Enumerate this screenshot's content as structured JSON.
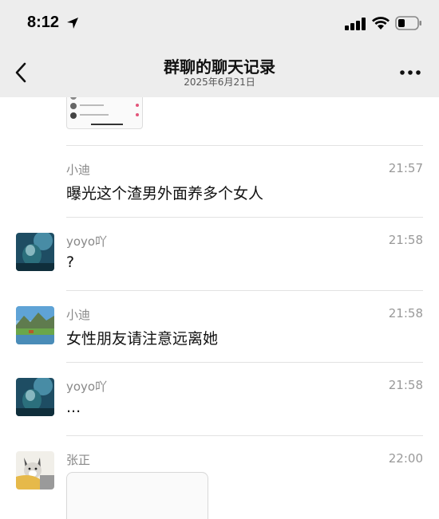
{
  "status_bar": {
    "time": "8:12"
  },
  "nav": {
    "title": "群聊的聊天记录",
    "subtitle": "2025年6月21日"
  },
  "messages": [
    {
      "sender": "小迪",
      "time": "21:57",
      "text": "曝光这个渣男外面养多个女人",
      "avatar": "none"
    },
    {
      "sender": "yoyo吖",
      "time": "21:58",
      "text": "?",
      "avatar": "underwater-photo"
    },
    {
      "sender": "小迪",
      "time": "21:58",
      "text": "女性朋友请注意远离她",
      "avatar": "landscape-photo"
    },
    {
      "sender": "yoyo吖",
      "time": "21:58",
      "text": "...",
      "avatar": "underwater-photo"
    },
    {
      "sender": "张正",
      "time": "22:00",
      "text": "",
      "avatar": "dog-photo"
    }
  ],
  "colors": {
    "header_bg": "#ededed",
    "divider": "#e2e2e2",
    "sender_text": "#888888"
  }
}
